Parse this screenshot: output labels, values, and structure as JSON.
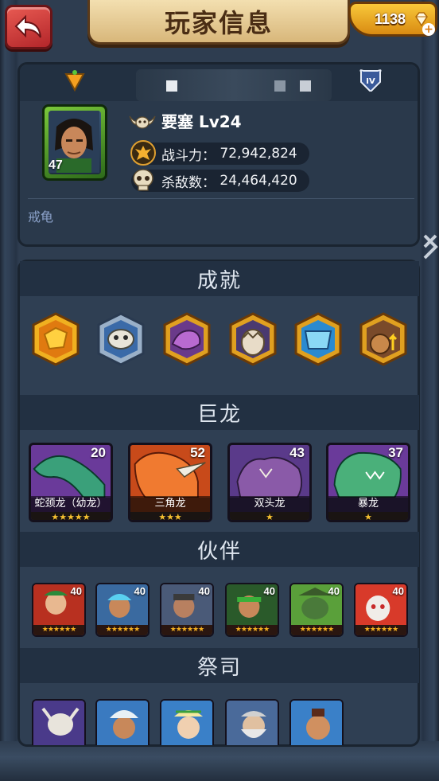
{
  "header": {
    "title": "玩家信息",
    "gems": "1138"
  },
  "profile": {
    "name_hidden": "",
    "avatar_level": "47",
    "guild_name": "要塞 Lv24",
    "power_label": "战斗力：",
    "power_value": "72,942,824",
    "kills_label": "杀敌数：",
    "kills_value": "24,464,420",
    "motto": "戒龟",
    "tier": "IV"
  },
  "sections": {
    "achievements": "成就",
    "dragons": "巨龙",
    "partners": "伙伴",
    "priests": "祭司"
  },
  "achievements": [
    {
      "icon": "gold-nugget-icon",
      "color": "#f0b020"
    },
    {
      "icon": "dragon-skull-icon",
      "color": "#9ab0c8"
    },
    {
      "icon": "purple-dragon-icon",
      "color": "#e0a020"
    },
    {
      "icon": "broken-egg-icon",
      "color": "#e0a020"
    },
    {
      "icon": "ice-dragon-icon",
      "color": "#e0a020"
    },
    {
      "icon": "gold-sack-upgrade-icon",
      "color": "#e0a020"
    }
  ],
  "dragons": [
    {
      "name": "蛇颈龙（幼龙）",
      "level": "20",
      "stars": "★★★★★",
      "color": "#3aa07a"
    },
    {
      "name": "三角龙",
      "level": "52",
      "stars": "★★★",
      "color": "#e06a2a"
    },
    {
      "name": "双头龙",
      "level": "43",
      "stars": "★",
      "color": "#6a3a8a"
    },
    {
      "name": "暴龙",
      "level": "37",
      "stars": "★",
      "color": "#3a9a6a"
    }
  ],
  "partners": [
    {
      "level": "40",
      "stars": "★★★★★★",
      "color": "#c83a2a"
    },
    {
      "level": "40",
      "stars": "★★★★★★",
      "color": "#3a6aa0"
    },
    {
      "level": "40",
      "stars": "★★★★★★",
      "color": "#5a6a80"
    },
    {
      "level": "40",
      "stars": "★★★★★★",
      "color": "#3a7a3a"
    },
    {
      "level": "40",
      "stars": "★★★★★★",
      "color": "#4a8a2a"
    },
    {
      "level": "40",
      "stars": "★★★★★★",
      "color": "#c82a2a"
    }
  ],
  "colors": {
    "panel": "#2f3f53",
    "header_bar": "#223042",
    "accent_gold": "#f5c030"
  }
}
